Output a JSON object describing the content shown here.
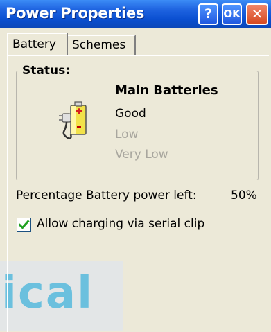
{
  "window": {
    "title": "Power Properties",
    "help_label": "?",
    "ok_label": "OK",
    "close_label": "✕"
  },
  "tabs": [
    {
      "label": "Battery",
      "selected": true
    },
    {
      "label": "Schemes",
      "selected": false
    }
  ],
  "status": {
    "group_label": "Status:",
    "battery_name": "Main Batteries",
    "levels": [
      {
        "label": "Good",
        "active": true
      },
      {
        "label": "Low",
        "active": false
      },
      {
        "label": "Very Low",
        "active": false
      }
    ],
    "icon": "battery-plug-icon"
  },
  "power": {
    "label": "Percentage Battery power left:",
    "value": "50%"
  },
  "charging": {
    "label": "Allow charging via serial clip",
    "checked": true
  },
  "watermark": {
    "text": "ical"
  },
  "colors": {
    "titlebar": "#0a4fd0",
    "background": "#ece9d8",
    "disabled_text": "#a8a69e",
    "check": "#21a121",
    "watermark": "#6bc0de"
  }
}
